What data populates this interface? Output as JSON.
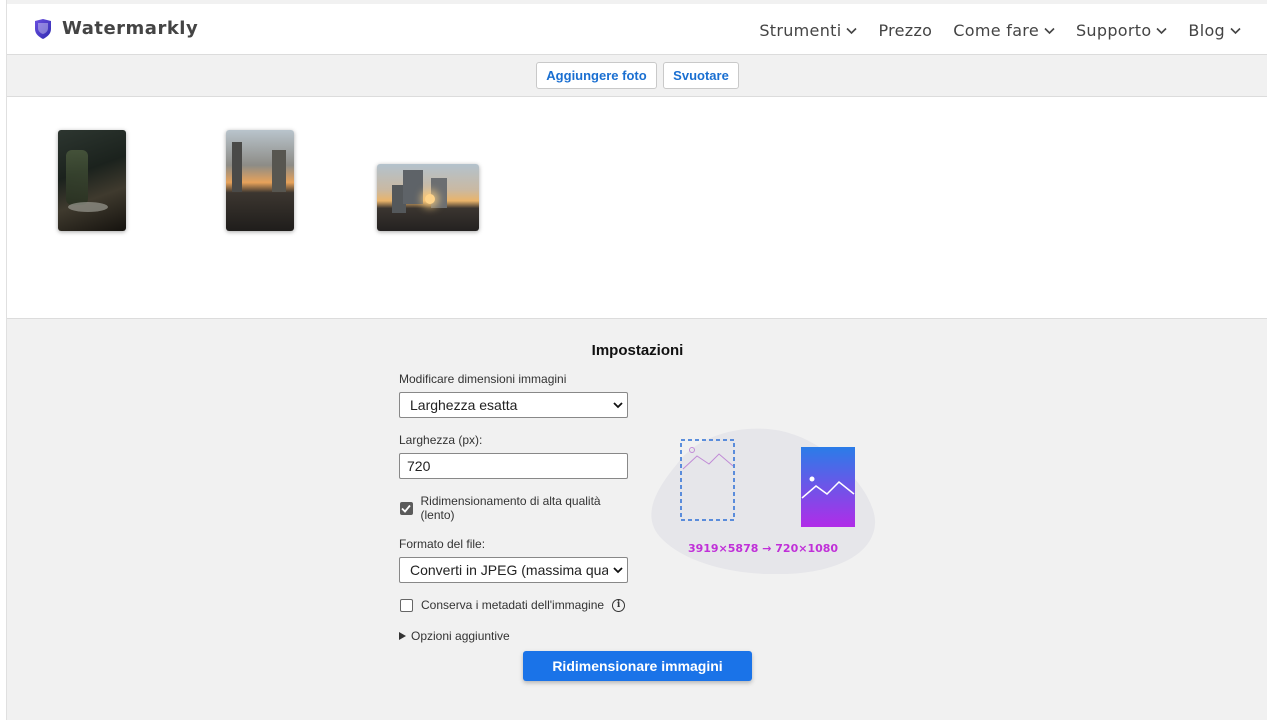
{
  "brand": {
    "name": "Watermarkly",
    "accent": "#5a3fd6"
  },
  "nav": [
    {
      "label": "Strumenti",
      "has_dropdown": true
    },
    {
      "label": "Prezzo",
      "has_dropdown": false
    },
    {
      "label": "Come fare",
      "has_dropdown": true
    },
    {
      "label": "Supporto",
      "has_dropdown": true
    },
    {
      "label": "Blog",
      "has_dropdown": true
    }
  ],
  "toolbar": {
    "add_label": "Aggiungere foto",
    "clear_label": "Svuotare"
  },
  "settings": {
    "title": "Impostazioni",
    "resize_mode": {
      "label": "Modificare dimensioni immagini",
      "value": "Larghezza esatta"
    },
    "width": {
      "label": "Larghezza (px):",
      "value": "720"
    },
    "high_quality": {
      "label": "Ridimensionamento di alta qualità (lento)",
      "checked": true
    },
    "format": {
      "label": "Formato del file:",
      "value": "Converti in JPEG (massima qualità, f"
    },
    "keep_metadata": {
      "label": "Conserva i metadati dell'immagine",
      "checked": false,
      "info_icon": "info-icon"
    },
    "additional_options": "Opzioni aggiuntive",
    "submit_label": "Ridimensionare immagini",
    "illustration_dims": "3919×5878 → 720×1080"
  },
  "colors": {
    "primary": "#1a73e8",
    "link": "#1a6fd1",
    "dims_text": "#c030d8"
  }
}
